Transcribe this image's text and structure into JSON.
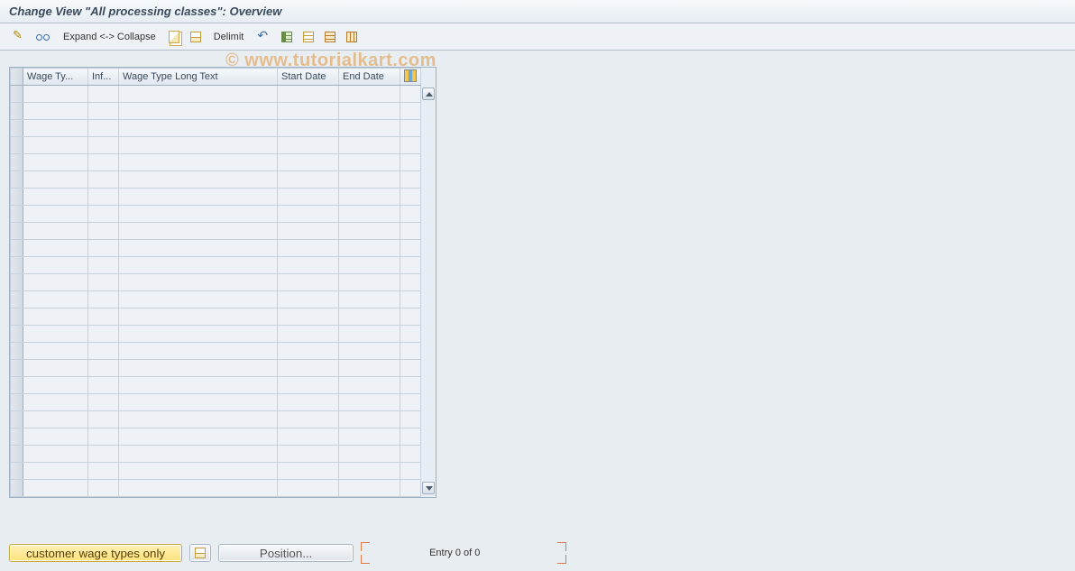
{
  "title": "Change View \"All processing classes\": Overview",
  "watermark": "© www.tutorialkart.com",
  "toolbar": {
    "expand_collapse_label": "Expand <-> Collapse",
    "delimit_label": "Delimit"
  },
  "table": {
    "columns": [
      "Wage Ty...",
      "Inf...",
      "Wage Type Long Text",
      "Start Date",
      "End Date"
    ],
    "visible_row_count": 24,
    "rows": []
  },
  "footer": {
    "customer_wt_label": "customer wage types only",
    "position_label": "Position...",
    "entry_text": "Entry 0 of 0"
  }
}
